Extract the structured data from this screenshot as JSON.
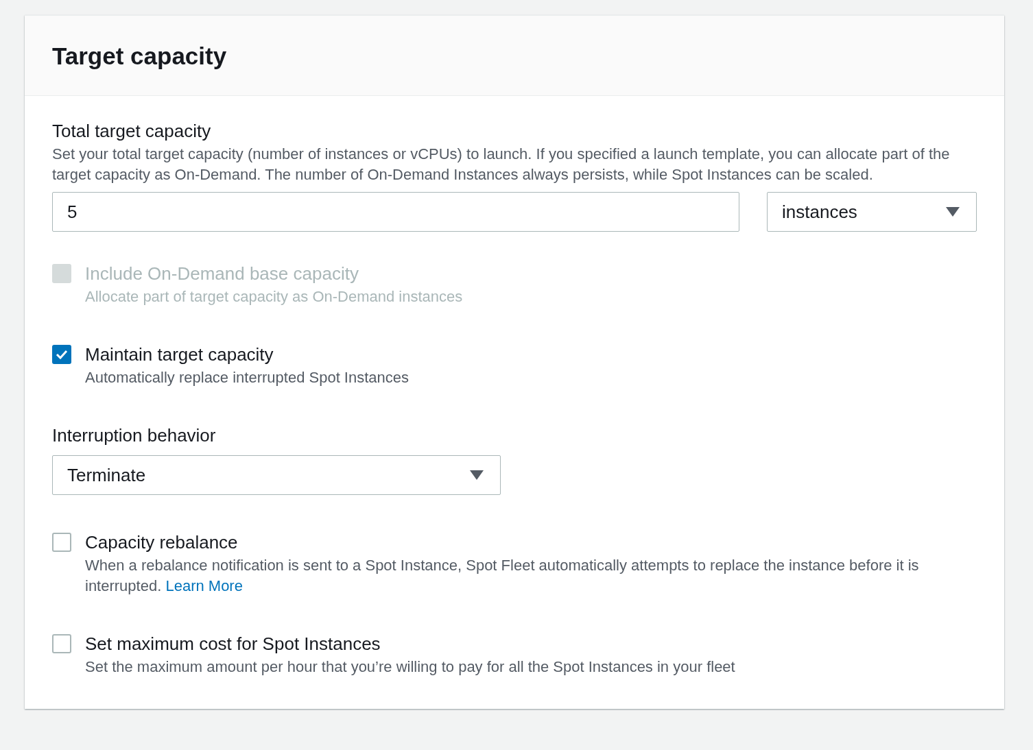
{
  "panel": {
    "title": "Target capacity"
  },
  "total_capacity": {
    "label": "Total target capacity",
    "description": "Set your total target capacity (number of instances or vCPUs) to launch. If you specified a launch template, you can allocate part of the target capacity as On-Demand. The number of On-Demand Instances always persists, while Spot Instances can be scaled.",
    "value": "5",
    "unit": "instances"
  },
  "fields": [
    {
      "kind": "checkbox",
      "label": "Include On-Demand base capacity",
      "description": "Allocate part of target capacity as On-Demand instances",
      "checked": false,
      "disabled": true
    },
    {
      "kind": "checkbox",
      "label": "Maintain target capacity",
      "description": "Automatically replace interrupted Spot Instances",
      "checked": true,
      "disabled": false
    },
    {
      "kind": "select",
      "label": "Interruption behavior",
      "value": "Terminate"
    },
    {
      "kind": "checkbox",
      "label": "Capacity rebalance",
      "description": "When a rebalance notification is sent to a Spot Instance, Spot Fleet automatically attempts to replace the instance before it is interrupted.",
      "link": "Learn More",
      "checked": false,
      "disabled": false
    },
    {
      "kind": "checkbox",
      "label": "Set maximum cost for Spot Instances",
      "description": "Set the maximum amount per hour that you’re willing to pay for all the Spot Instances in your fleet",
      "checked": false,
      "disabled": false
    }
  ]
}
